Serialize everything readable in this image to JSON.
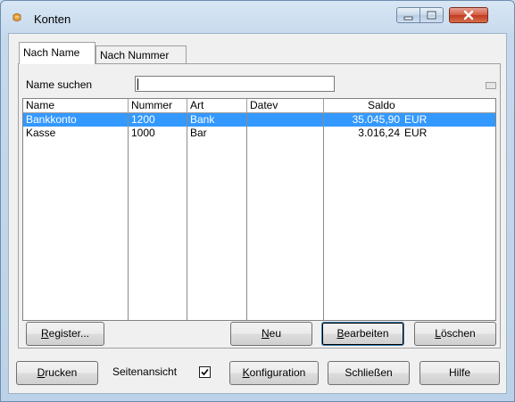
{
  "window": {
    "title": "Konten"
  },
  "tabs": [
    {
      "label": "Nach Name",
      "active": true
    },
    {
      "label": "Nach Nummer",
      "active": false
    }
  ],
  "search": {
    "label": "Name suchen",
    "value": ""
  },
  "grid": {
    "columns": [
      "Name",
      "Nummer",
      "Art",
      "Datev",
      "Saldo"
    ],
    "rows": [
      {
        "name": "Bankkonto",
        "nummer": "1200",
        "art": "Bank",
        "datev": "",
        "saldo": "35.045,90",
        "currency": "EUR",
        "selected": true
      },
      {
        "name": "Kasse",
        "nummer": "1000",
        "art": "Bar",
        "datev": "",
        "saldo": "3.016,24",
        "currency": "EUR",
        "selected": false
      }
    ]
  },
  "panel_buttons": {
    "register": {
      "pre": "",
      "key": "R",
      "post": "egister..."
    },
    "neu": {
      "pre": "",
      "key": "N",
      "post": "eu"
    },
    "bearbeiten": {
      "pre": "",
      "key": "B",
      "post": "earbeiten"
    },
    "loeschen": {
      "pre": "",
      "key": "L",
      "post": "öschen"
    }
  },
  "footer": {
    "drucken": {
      "pre": "",
      "key": "D",
      "post": "rucken"
    },
    "seitenansicht_label": "Seitenansicht",
    "seitenansicht_checked": true,
    "konfiguration": {
      "pre": "",
      "key": "K",
      "post": "onfiguration"
    },
    "schliessen": "Schließen",
    "hilfe": "Hilfe"
  },
  "colors": {
    "selection": "#3399ff",
    "close_button": "#c8452b",
    "frame": "#c9dcee"
  }
}
